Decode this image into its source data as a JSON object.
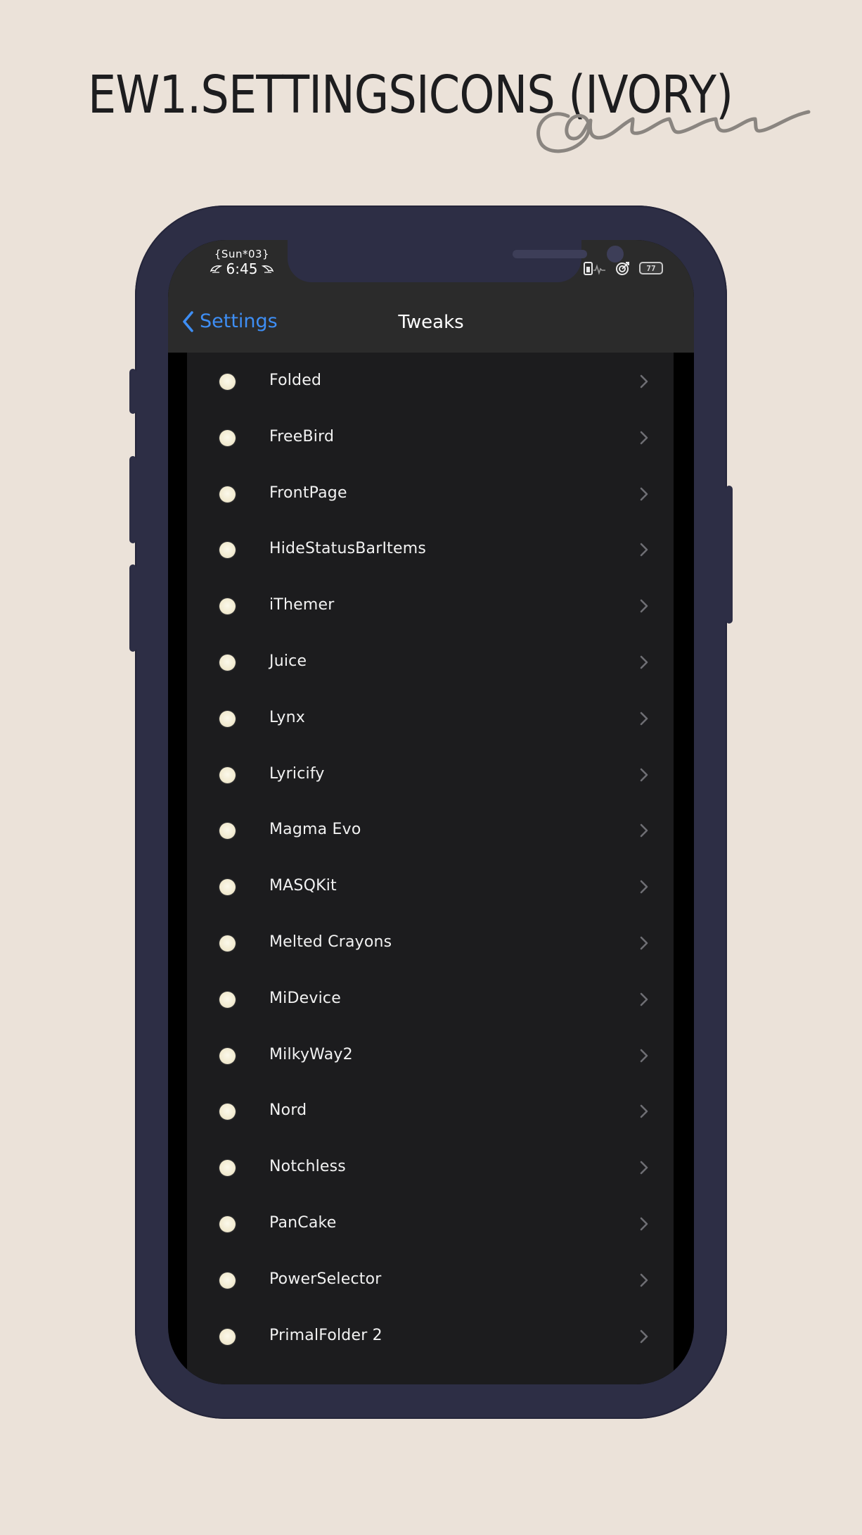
{
  "poster": {
    "title": "EW1.SETTINGSICONS (IVORY)",
    "signature": "@nam"
  },
  "status_bar": {
    "date": "{Sun*03}",
    "time": "6:45",
    "battery": "77"
  },
  "nav": {
    "back_label": "Settings",
    "title": "Tweaks"
  },
  "list": [
    {
      "label": "Folded"
    },
    {
      "label": "FreeBird"
    },
    {
      "label": "FrontPage"
    },
    {
      "label": "HideStatusBarItems"
    },
    {
      "label": "iThemer"
    },
    {
      "label": "Juice"
    },
    {
      "label": "Lynx"
    },
    {
      "label": "Lyricify"
    },
    {
      "label": "Magma Evo"
    },
    {
      "label": "MASQKit"
    },
    {
      "label": "Melted Crayons"
    },
    {
      "label": "MiDevice"
    },
    {
      "label": "MilkyWay2"
    },
    {
      "label": "Nord"
    },
    {
      "label": "Notchless"
    },
    {
      "label": "PanCake"
    },
    {
      "label": "PowerSelector"
    },
    {
      "label": "PrimalFolder 2"
    }
  ],
  "colors": {
    "background": "#ebe2d9",
    "phone_frame": "#2d2e45",
    "row_background": "#1c1c1e",
    "accent": "#3e8ef4",
    "icon_dot": "#f2ebd1"
  }
}
